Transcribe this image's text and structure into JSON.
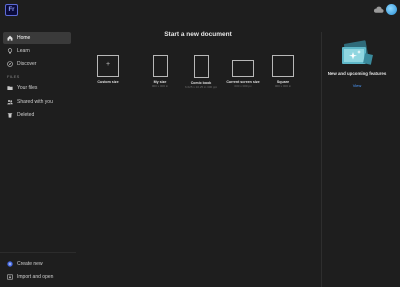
{
  "app": {
    "logo_text": "Fr"
  },
  "sidebar": {
    "items": [
      {
        "label": "Home",
        "icon": "home-icon",
        "active": true
      },
      {
        "label": "Learn",
        "icon": "lightbulb-icon",
        "active": false
      },
      {
        "label": "Discover",
        "icon": "compass-icon",
        "active": false
      }
    ],
    "files_section_label": "FILES",
    "file_items": [
      {
        "label": "Your files",
        "icon": "folder-icon"
      },
      {
        "label": "Shared with you",
        "icon": "people-icon"
      },
      {
        "label": "Deleted",
        "icon": "trash-icon"
      }
    ],
    "bottom_items": [
      {
        "label": "Create new",
        "icon": "plus-circle-icon"
      },
      {
        "label": "Import and open",
        "icon": "import-icon"
      }
    ]
  },
  "main": {
    "title": "Start a new document",
    "presets": [
      {
        "name": "Custom size",
        "dims": ""
      },
      {
        "name": "My size",
        "dims": "000 x 000 in"
      },
      {
        "name": "Comic book",
        "dims": "6.625 x 10.25 in 300 ppi"
      },
      {
        "name": "Current screen size",
        "dims": "000 x 000 px"
      },
      {
        "name": "Square",
        "dims": "000 x 000 in"
      }
    ]
  },
  "news": {
    "title": "New and upcoming features",
    "link": "View"
  },
  "colors": {
    "background": "#1e1e1e",
    "active_item": "#3a3a3a",
    "link": "#4d9bff",
    "logo_accent": "#5c6bd6"
  }
}
